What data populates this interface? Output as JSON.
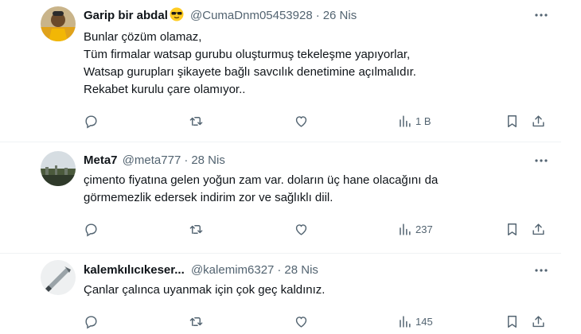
{
  "tweets": [
    {
      "name": "Garip bir abdal",
      "has_emoji": "sunglasses-emoji",
      "handle": "@CumaDnm05453928",
      "time": "26 Nis",
      "text": "Bunlar çözüm olamaz,\nTüm firmalar watsap gurubu oluşturmuş tekeleşme yapıyorlar,\nWatsap gurupları şikayete bağlı savcılık denetimine açılmalıdır.\nRekabet kurulu çare olamıyor..",
      "views": "1 B"
    },
    {
      "name": "Meta7",
      "handle": "@meta777",
      "time": "28 Nis",
      "text": "çimento fiyatına gelen yoğun zam var. doların üç hane olacağını da\ngörmemezlik edersek indirim zor ve sağlıklı diil.",
      "views": "237"
    },
    {
      "name": "kalemkılıcıkeser...",
      "handle": "@kalemim6327",
      "time": "28 Nis",
      "text": "Çanlar çalınca uyanmak için çok geç kaldınız.",
      "views": "145"
    }
  ],
  "colors": {
    "text": "#0f1419",
    "muted": "#536471",
    "divider": "#eff3f4"
  }
}
